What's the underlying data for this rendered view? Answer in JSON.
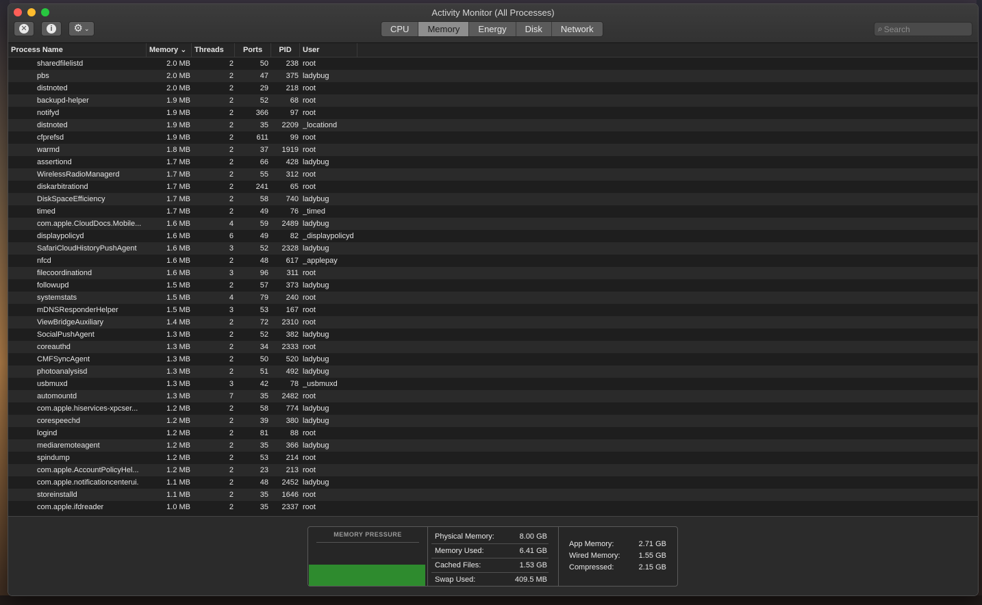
{
  "window": {
    "title": "Activity Monitor (All Processes)"
  },
  "toolbar": {
    "stop_glyph": "✕",
    "info_glyph": "i",
    "gear_glyph": "⚙",
    "chevron_glyph": "⌄",
    "tabs": [
      {
        "label": "CPU",
        "active": false
      },
      {
        "label": "Memory",
        "active": true
      },
      {
        "label": "Energy",
        "active": false
      },
      {
        "label": "Disk",
        "active": false
      },
      {
        "label": "Network",
        "active": false
      }
    ],
    "search": {
      "icon": "⌕",
      "placeholder": "Search"
    }
  },
  "columns": {
    "name": "Process Name",
    "memory": "Memory ⌄",
    "threads": "Threads",
    "ports": "Ports",
    "pid": "PID",
    "user": "User"
  },
  "rows": [
    {
      "name": "sharedfilelistd",
      "memory": "2.0 MB",
      "threads": "2",
      "ports": "50",
      "pid": "238",
      "user": "root"
    },
    {
      "name": "pbs",
      "memory": "2.0 MB",
      "threads": "2",
      "ports": "47",
      "pid": "375",
      "user": "ladybug"
    },
    {
      "name": "distnoted",
      "memory": "2.0 MB",
      "threads": "2",
      "ports": "29",
      "pid": "218",
      "user": "root"
    },
    {
      "name": "backupd-helper",
      "memory": "1.9 MB",
      "threads": "2",
      "ports": "52",
      "pid": "68",
      "user": "root"
    },
    {
      "name": "notifyd",
      "memory": "1.9 MB",
      "threads": "2",
      "ports": "366",
      "pid": "97",
      "user": "root"
    },
    {
      "name": "distnoted",
      "memory": "1.9 MB",
      "threads": "2",
      "ports": "35",
      "pid": "2209",
      "user": "_locationd"
    },
    {
      "name": "cfprefsd",
      "memory": "1.9 MB",
      "threads": "2",
      "ports": "611",
      "pid": "99",
      "user": "root"
    },
    {
      "name": "warmd",
      "memory": "1.8 MB",
      "threads": "2",
      "ports": "37",
      "pid": "1919",
      "user": "root"
    },
    {
      "name": "assertiond",
      "memory": "1.7 MB",
      "threads": "2",
      "ports": "66",
      "pid": "428",
      "user": "ladybug"
    },
    {
      "name": "WirelessRadioManagerd",
      "memory": "1.7 MB",
      "threads": "2",
      "ports": "55",
      "pid": "312",
      "user": "root"
    },
    {
      "name": "diskarbitrationd",
      "memory": "1.7 MB",
      "threads": "2",
      "ports": "241",
      "pid": "65",
      "user": "root"
    },
    {
      "name": "DiskSpaceEfficiency",
      "memory": "1.7 MB",
      "threads": "2",
      "ports": "58",
      "pid": "740",
      "user": "ladybug"
    },
    {
      "name": "timed",
      "memory": "1.7 MB",
      "threads": "2",
      "ports": "49",
      "pid": "76",
      "user": "_timed"
    },
    {
      "name": "com.apple.CloudDocs.Mobile...",
      "memory": "1.6 MB",
      "threads": "4",
      "ports": "59",
      "pid": "2489",
      "user": "ladybug"
    },
    {
      "name": "displaypolicyd",
      "memory": "1.6 MB",
      "threads": "6",
      "ports": "49",
      "pid": "82",
      "user": "_displaypolicyd"
    },
    {
      "name": "SafariCloudHistoryPushAgent",
      "memory": "1.6 MB",
      "threads": "3",
      "ports": "52",
      "pid": "2328",
      "user": "ladybug"
    },
    {
      "name": "nfcd",
      "memory": "1.6 MB",
      "threads": "2",
      "ports": "48",
      "pid": "617",
      "user": "_applepay"
    },
    {
      "name": "filecoordinationd",
      "memory": "1.6 MB",
      "threads": "3",
      "ports": "96",
      "pid": "311",
      "user": "root"
    },
    {
      "name": "followupd",
      "memory": "1.5 MB",
      "threads": "2",
      "ports": "57",
      "pid": "373",
      "user": "ladybug"
    },
    {
      "name": "systemstats",
      "memory": "1.5 MB",
      "threads": "4",
      "ports": "79",
      "pid": "240",
      "user": "root"
    },
    {
      "name": "mDNSResponderHelper",
      "memory": "1.5 MB",
      "threads": "3",
      "ports": "53",
      "pid": "167",
      "user": "root"
    },
    {
      "name": "ViewBridgeAuxiliary",
      "memory": "1.4 MB",
      "threads": "2",
      "ports": "72",
      "pid": "2310",
      "user": "root"
    },
    {
      "name": "SocialPushAgent",
      "memory": "1.3 MB",
      "threads": "2",
      "ports": "52",
      "pid": "382",
      "user": "ladybug"
    },
    {
      "name": "coreauthd",
      "memory": "1.3 MB",
      "threads": "2",
      "ports": "34",
      "pid": "2333",
      "user": "root"
    },
    {
      "name": "CMFSyncAgent",
      "memory": "1.3 MB",
      "threads": "2",
      "ports": "50",
      "pid": "520",
      "user": "ladybug"
    },
    {
      "name": "photoanalysisd",
      "memory": "1.3 MB",
      "threads": "2",
      "ports": "51",
      "pid": "492",
      "user": "ladybug"
    },
    {
      "name": "usbmuxd",
      "memory": "1.3 MB",
      "threads": "3",
      "ports": "42",
      "pid": "78",
      "user": "_usbmuxd"
    },
    {
      "name": "automountd",
      "memory": "1.3 MB",
      "threads": "7",
      "ports": "35",
      "pid": "2482",
      "user": "root"
    },
    {
      "name": "com.apple.hiservices-xpcser...",
      "memory": "1.2 MB",
      "threads": "2",
      "ports": "58",
      "pid": "774",
      "user": "ladybug"
    },
    {
      "name": "corespeechd",
      "memory": "1.2 MB",
      "threads": "2",
      "ports": "39",
      "pid": "380",
      "user": "ladybug"
    },
    {
      "name": "logind",
      "memory": "1.2 MB",
      "threads": "2",
      "ports": "81",
      "pid": "88",
      "user": "root"
    },
    {
      "name": "mediaremoteagent",
      "memory": "1.2 MB",
      "threads": "2",
      "ports": "35",
      "pid": "366",
      "user": "ladybug"
    },
    {
      "name": "spindump",
      "memory": "1.2 MB",
      "threads": "2",
      "ports": "53",
      "pid": "214",
      "user": "root"
    },
    {
      "name": "com.apple.AccountPolicyHel...",
      "memory": "1.2 MB",
      "threads": "2",
      "ports": "23",
      "pid": "213",
      "user": "root"
    },
    {
      "name": "com.apple.notificationcenterui.",
      "memory": "1.1 MB",
      "threads": "2",
      "ports": "48",
      "pid": "2452",
      "user": "ladybug"
    },
    {
      "name": "storeinstalld",
      "memory": "1.1 MB",
      "threads": "2",
      "ports": "35",
      "pid": "1646",
      "user": "root"
    },
    {
      "name": "com.apple.ifdreader",
      "memory": "1.0 MB",
      "threads": "2",
      "ports": "35",
      "pid": "2337",
      "user": "root"
    }
  ],
  "memory_panel": {
    "pressure_title": "MEMORY PRESSURE",
    "pressure_color": "#2e8b2e",
    "stats": [
      {
        "label": "Physical Memory:",
        "value": "8.00 GB"
      },
      {
        "label": "Memory Used:",
        "value": "6.41 GB"
      },
      {
        "label": "Cached Files:",
        "value": "1.53 GB"
      },
      {
        "label": "Swap Used:",
        "value": "409.5 MB"
      }
    ],
    "breakdown": [
      {
        "label": "App Memory:",
        "value": "2.71 GB"
      },
      {
        "label": "Wired Memory:",
        "value": "1.55 GB"
      },
      {
        "label": "Compressed:",
        "value": "2.15 GB"
      }
    ]
  }
}
